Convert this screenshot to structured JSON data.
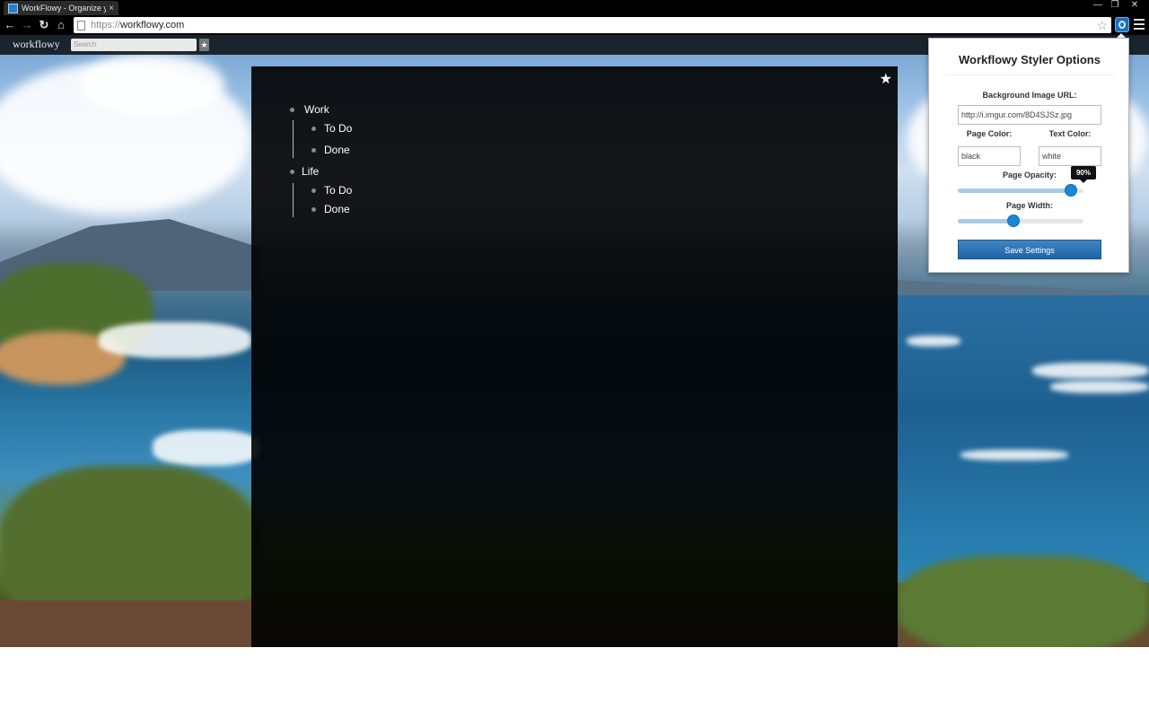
{
  "browser": {
    "tab_title": "WorkFlowy - Organize yo",
    "tab_close": "×",
    "url_prefix": "https://",
    "url_host": "workflowy.com",
    "window_controls": [
      "—",
      "❐",
      "✕"
    ]
  },
  "workflowy": {
    "logo": "workflowy",
    "search_placeholder": "Search",
    "outline": [
      {
        "label": "Work",
        "children": [
          "To Do",
          "Done"
        ]
      },
      {
        "label": "Life",
        "children": [
          "To Do",
          "Done"
        ]
      }
    ]
  },
  "popup": {
    "title": "Workflowy Styler Options",
    "bg_url_label": "Background Image URL:",
    "bg_url_value": "http://i.imgur.com/8D4SJSz.jpg",
    "page_color_label": "Page Color:",
    "page_color_value": "black",
    "text_color_label": "Text Color:",
    "text_color_value": "white",
    "opacity_label": "Page Opacity:",
    "opacity_value": 0.9,
    "opacity_tooltip": "90%",
    "width_label": "Page Width:",
    "width_value": 0.44,
    "save_label": "Save Settings"
  },
  "colors": {
    "accent": "#1a86d6",
    "save_button": "#2a72b5",
    "page_bg": "#000000"
  },
  "icons": [
    "back-icon",
    "forward-icon",
    "reload-icon",
    "home-icon",
    "bookmark-star-icon",
    "extension-icon",
    "menu-icon",
    "star-icon"
  ]
}
